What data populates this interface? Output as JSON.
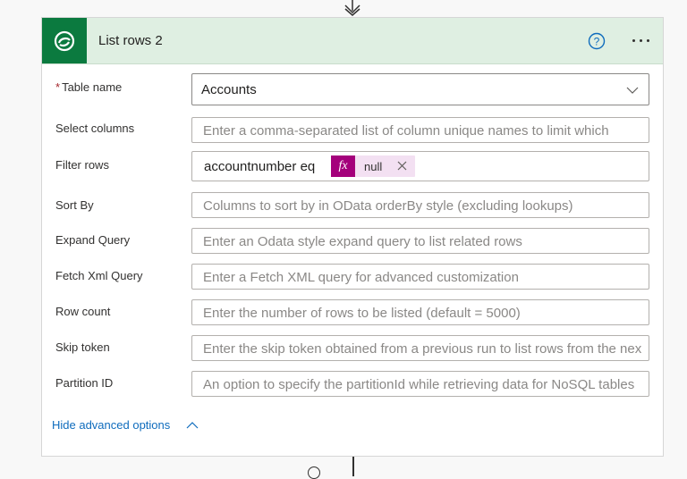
{
  "action": {
    "title": "List rows 2"
  },
  "fields": {
    "table_name": {
      "label": "Table name",
      "required_mark": "*",
      "value": "Accounts"
    },
    "select_columns": {
      "label": "Select columns",
      "placeholder": "Enter a comma-separated list of column unique names to limit which"
    },
    "filter_rows": {
      "label": "Filter rows",
      "text": "accountnumber eq",
      "token_icon": "fx",
      "token_value": "null"
    },
    "sort_by": {
      "label": "Sort By",
      "placeholder": "Columns to sort by in OData orderBy style (excluding lookups)"
    },
    "expand_query": {
      "label": "Expand Query",
      "placeholder": "Enter an Odata style expand query to list related rows"
    },
    "fetch_xml": {
      "label": "Fetch Xml Query",
      "placeholder": "Enter a Fetch XML query for advanced customization"
    },
    "row_count": {
      "label": "Row count",
      "placeholder": "Enter the number of rows to be listed (default = 5000)"
    },
    "skip_token": {
      "label": "Skip token",
      "placeholder": "Enter the skip token obtained from a previous run to list rows from the next page"
    },
    "partition_id": {
      "label": "Partition ID",
      "placeholder": "An option to specify the partitionId while retrieving data for NoSQL tables"
    }
  },
  "advanced_toggle": {
    "label": "Hide advanced options"
  },
  "colors": {
    "header_bg": "#dfefe2",
    "logo_bg": "#0b7a3f",
    "link": "#0f6cbd",
    "token_bg": "#f3e0f2",
    "token_icon_bg": "#a4007b",
    "required": "#a4262c"
  },
  "icons": [
    "down-arrow-connector-icon",
    "dataverse-logo-icon",
    "help-icon",
    "more-options-icon",
    "chevron-down-icon",
    "fx-icon",
    "remove-token-icon",
    "chevron-up-icon",
    "add-step-icon"
  ]
}
